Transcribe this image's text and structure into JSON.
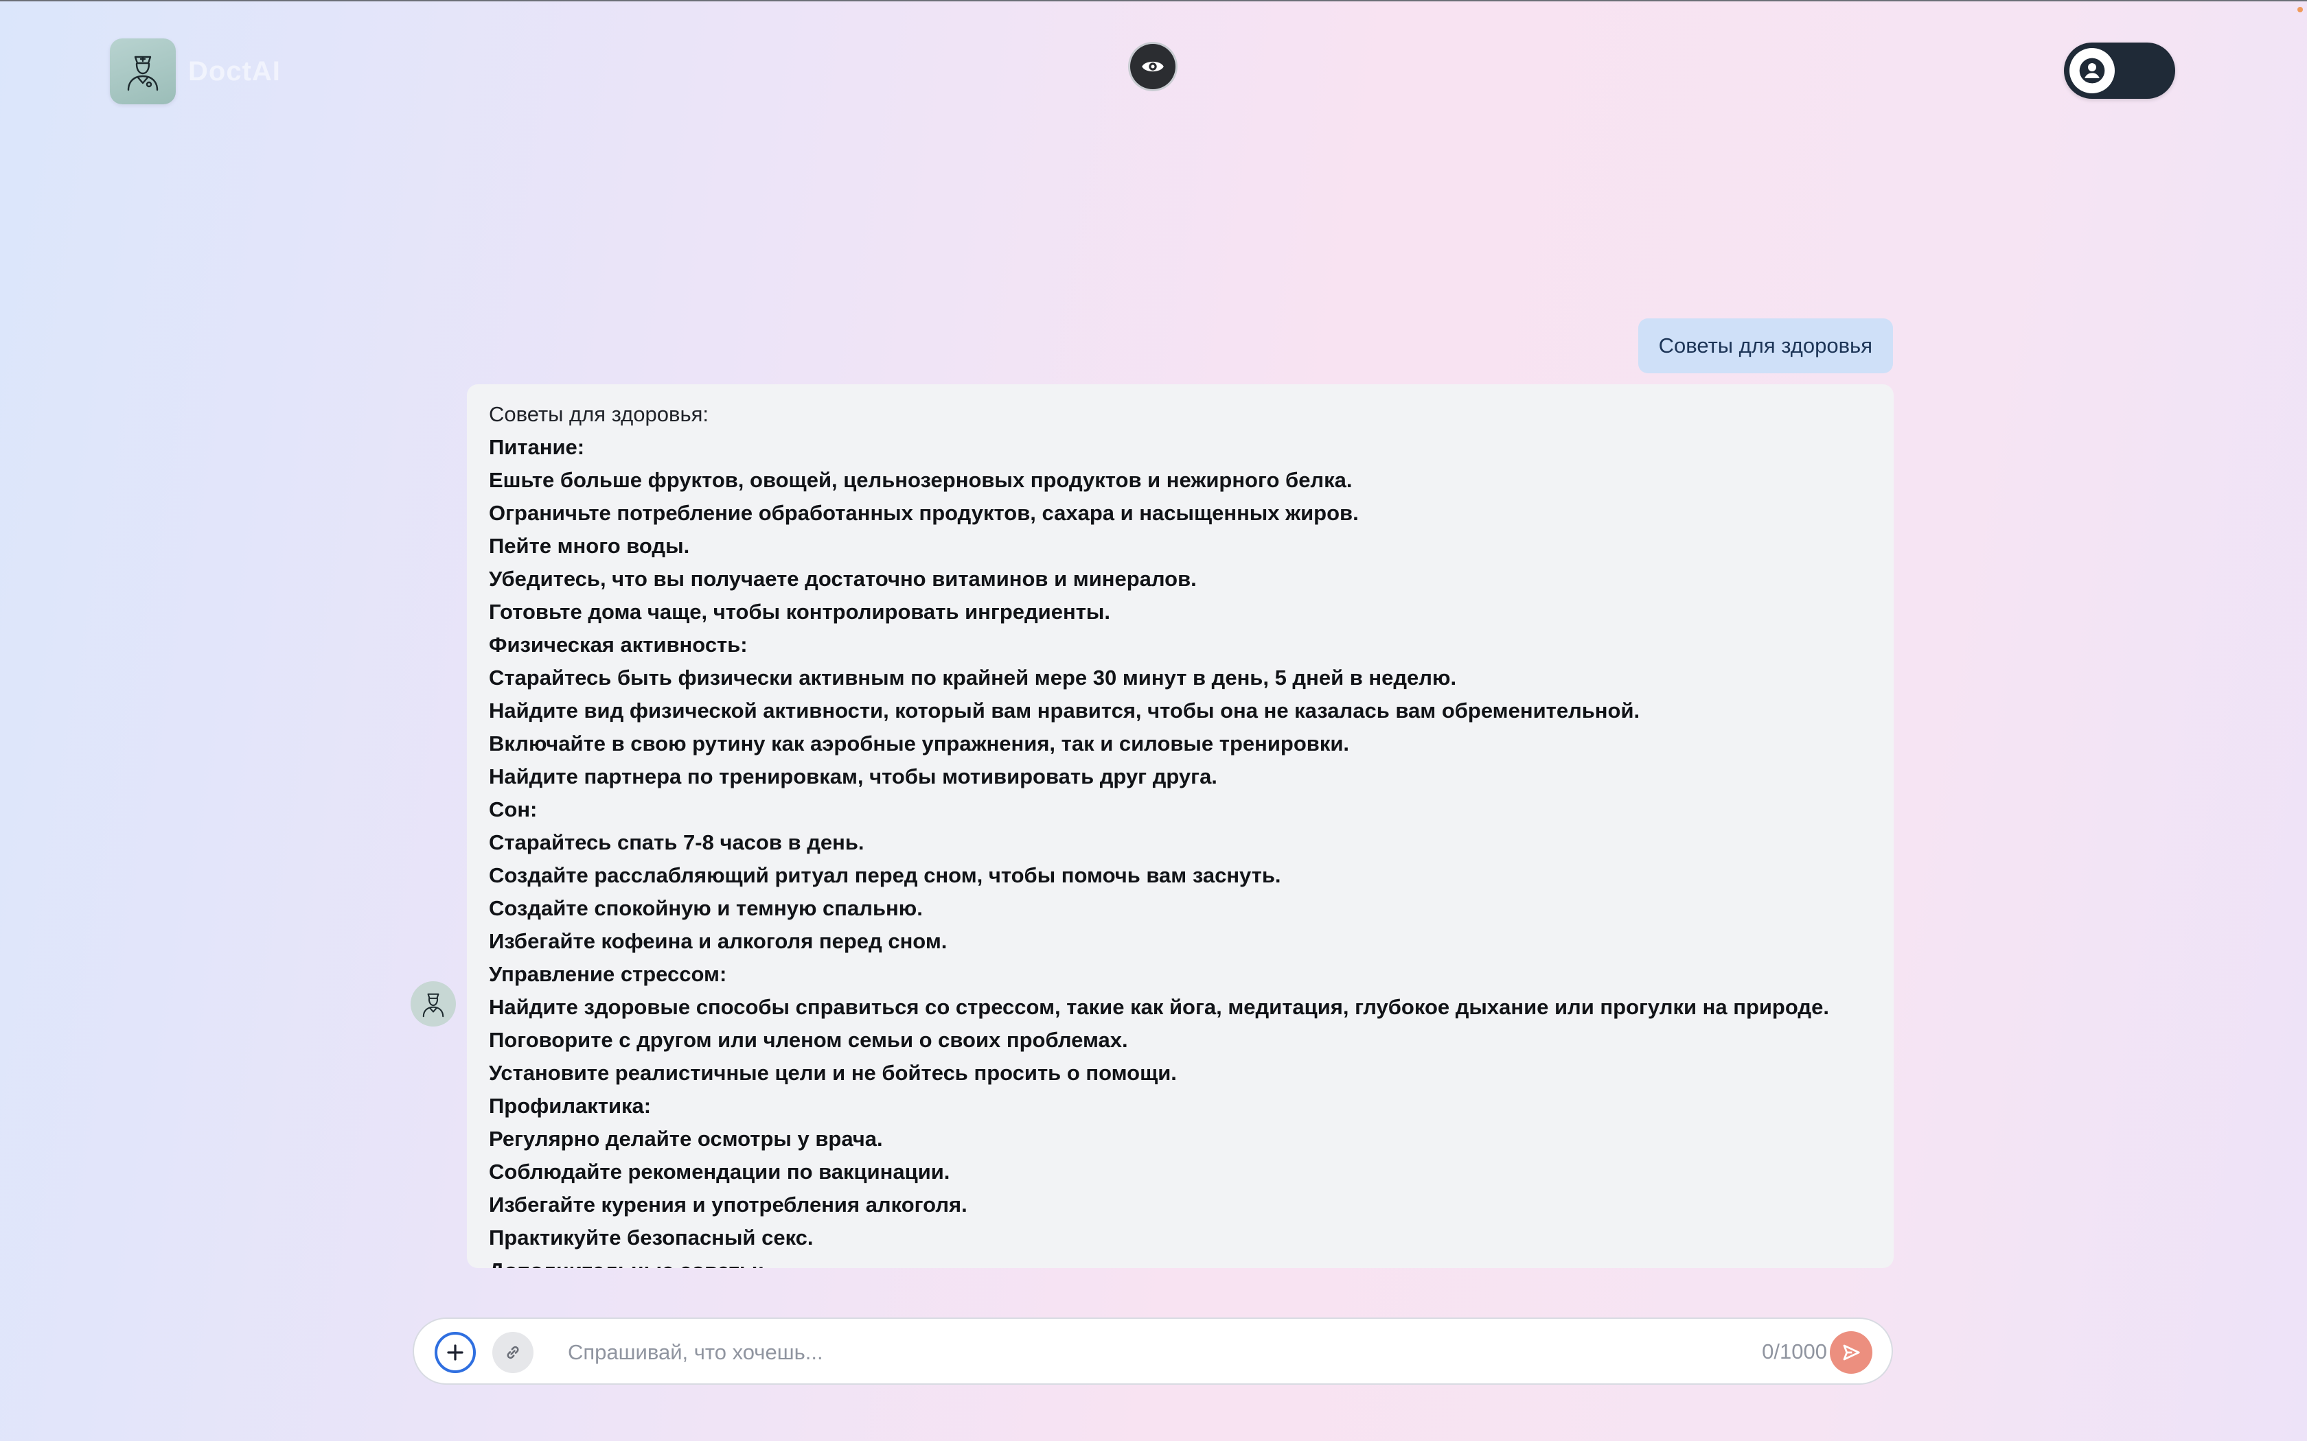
{
  "header": {
    "brand_name": "DoctAI",
    "logo_icon": "doctor-icon",
    "eye_icon": "eye-icon",
    "toggle_icon": "user-icon"
  },
  "chat": {
    "user_message": "Советы для здоровья",
    "bot_lines": [
      {
        "text": "Советы для здоровья:",
        "bold": false
      },
      {
        "text": "Питание:",
        "bold": true
      },
      {
        "text": "Ешьте больше фруктов, овощей, цельнозерновых продуктов и нежирного белка.",
        "bold": true
      },
      {
        "text": "Ограничьте потребление обработанных продуктов, сахара и насыщенных жиров.",
        "bold": true
      },
      {
        "text": "Пейте много воды.",
        "bold": true
      },
      {
        "text": "Убедитесь, что вы получаете достаточно витаминов и минералов.",
        "bold": true
      },
      {
        "text": "Готовьте дома чаще, чтобы контролировать ингредиенты.",
        "bold": true
      },
      {
        "text": "Физическая активность:",
        "bold": true
      },
      {
        "text": "Старайтесь быть физически активным по крайней мере 30 минут в день, 5 дней в неделю.",
        "bold": true
      },
      {
        "text": "Найдите вид физической активности, который вам нравится, чтобы она не казалась вам обременительной.",
        "bold": true
      },
      {
        "text": "Включайте в свою рутину как аэробные упражнения, так и силовые тренировки.",
        "bold": true
      },
      {
        "text": "Найдите партнера по тренировкам, чтобы мотивировать друг друга.",
        "bold": true
      },
      {
        "text": "Сон:",
        "bold": true
      },
      {
        "text": "Старайтесь спать 7-8 часов в день.",
        "bold": true
      },
      {
        "text": "Создайте расслабляющий ритуал перед сном, чтобы помочь вам заснуть.",
        "bold": true
      },
      {
        "text": "Создайте спокойную и темную спальню.",
        "bold": true
      },
      {
        "text": "Избегайте кофеина и алкоголя перед сном.",
        "bold": true
      },
      {
        "text": "Управление стрессом:",
        "bold": true
      },
      {
        "text": "Найдите здоровые способы справиться со стрессом, такие как йога, медитация, глубокое дыхание или прогулки на природе.",
        "bold": true
      },
      {
        "text": "Поговорите с другом или членом семьи о своих проблемах.",
        "bold": true
      },
      {
        "text": "Установите реалистичные цели и не бойтесь просить о помощи.",
        "bold": true
      },
      {
        "text": "Профилактика:",
        "bold": true
      },
      {
        "text": "Регулярно делайте осмотры у врача.",
        "bold": true
      },
      {
        "text": "Соблюдайте рекомендации по вакцинации.",
        "bold": true
      },
      {
        "text": "Избегайте курения и употребления алкоголя.",
        "bold": true
      },
      {
        "text": "Практикуйте безопасный секс.",
        "bold": true
      },
      {
        "text": "Дополнительные советы:",
        "bold": true
      }
    ]
  },
  "composer": {
    "placeholder": "Спрашивай, что хочешь...",
    "value": "",
    "char_count": "0/1000",
    "add_icon": "plus-icon",
    "attach_icon": "link-icon",
    "send_icon": "send-icon"
  }
}
